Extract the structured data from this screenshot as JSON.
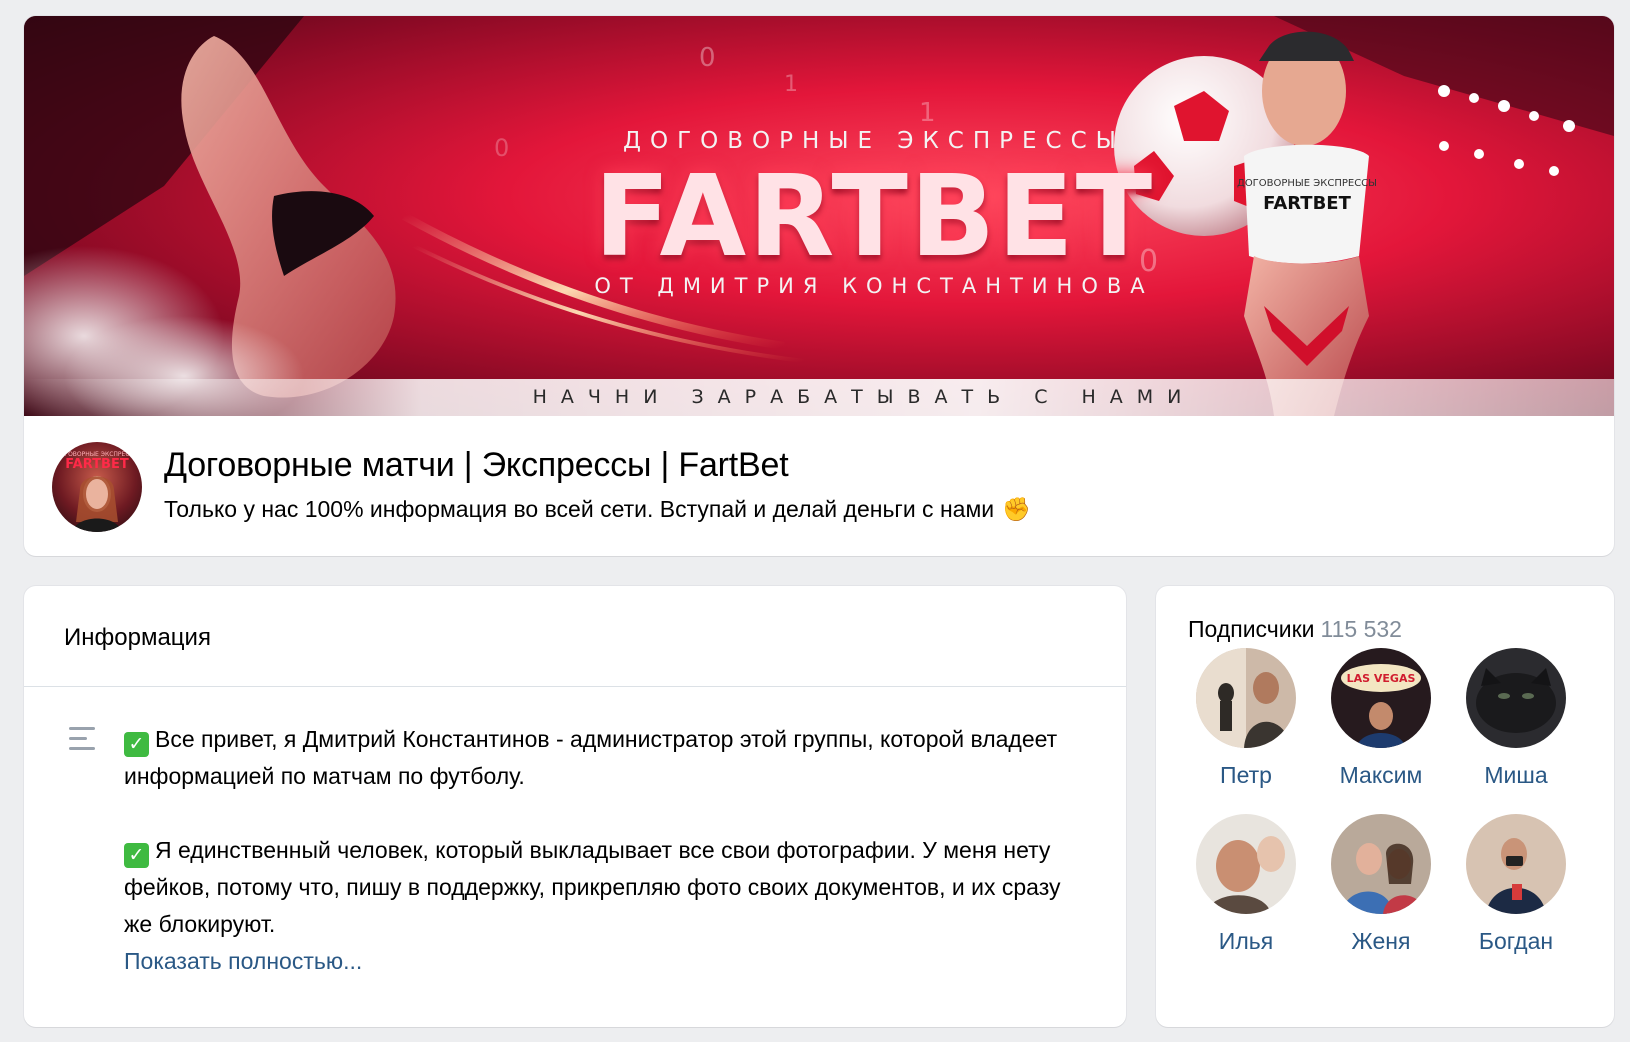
{
  "cover": {
    "subtitle": "ДОГОВОРНЫЕ ЭКСПРЕССЫ",
    "logo": "FARTBET",
    "author": "ОТ ДМИТРИЯ КОНСТАНТИНОВА",
    "tagline": "НАЧНИ ЗАРАБАТЫВАТЬ С НАМИ",
    "shirt_small": "ДОГОВОРНЫЕ ЭКСПРЕССЫ",
    "shirt_logo": "FARTBET",
    "avatar_small": "ДОГОВОРНЫЕ ЭКСПРЕССЫ",
    "avatar_logo": "FARTBET",
    "vegas_sign": "LAS VEGAS"
  },
  "group": {
    "name": "Договорные матчи | Экспрессы | FartBet",
    "status": "Только у нас 100% информация во всей сети. Вступай и делай деньги с нами",
    "status_emoji": "✊"
  },
  "info": {
    "title": "Информация",
    "check_glyph": "✓",
    "paragraph1": "Все привет, я Дмитрий Константинов - администратор этой группы, которой владеет информацией по матчам по футболу.",
    "paragraph2": "Я единственный человек, который выкладывает все свои фотографии. У меня нету фейков, потому что, пишу в поддержку, прикрепляю фото своих документов, и их сразу же блокируют.",
    "show_more": "Показать полностью..."
  },
  "members": {
    "label": "Подписчики",
    "count": "115 532",
    "list": [
      {
        "name": "Петр"
      },
      {
        "name": "Максим"
      },
      {
        "name": "Миша"
      },
      {
        "name": "Илья"
      },
      {
        "name": "Женя"
      },
      {
        "name": "Богдан"
      }
    ]
  },
  "colors": {
    "link": "#2a5885",
    "muted": "#818c99",
    "background": "#edeef0",
    "check": "#3fba41"
  }
}
